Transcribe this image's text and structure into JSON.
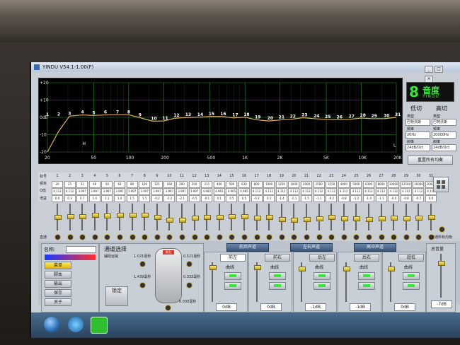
{
  "window": {
    "title": "YINDU V54.1-1.00(F)"
  },
  "graph": {
    "y_labels": [
      "+20",
      "+10",
      "0dB",
      "-10",
      "-20"
    ],
    "x_labels": [
      "20",
      "50",
      "100",
      "200",
      "500",
      "1K",
      "2K",
      "5K",
      "10K",
      "20K"
    ],
    "band_markers": [
      "1",
      "2",
      "3",
      "4",
      "5",
      "6",
      "7",
      "8",
      "9",
      "10",
      "11",
      "12",
      "13",
      "14",
      "15",
      "16",
      "17",
      "18",
      "19",
      "20",
      "21",
      "22",
      "23",
      "24",
      "25",
      "26",
      "27",
      "28",
      "29",
      "30",
      "31"
    ],
    "hp_marker": "H",
    "lp_marker": "L"
  },
  "logo": {
    "digit": "8",
    "cn": "音度",
    "en": "YINDU"
  },
  "filters": {
    "low_cut": "低切",
    "high_cut": "高切",
    "type_label": "类型",
    "freq_label": "频率",
    "slope_label": "斜率",
    "low_type": "巴特沃斯",
    "high_type": "巴特沃斯",
    "low_freq": "20Hz",
    "high_freq": "20000Hz",
    "low_slope": "24dB/Oct",
    "high_slope": "24dB/Oct",
    "reset_button": "重置所有均衡"
  },
  "eq": {
    "row_labels": [
      "标号",
      "频率",
      "Q值",
      "增益"
    ],
    "bands": [
      "1",
      "2",
      "3",
      "4",
      "5",
      "6",
      "7",
      "8",
      "9",
      "10",
      "11",
      "12",
      "13",
      "14",
      "15",
      "16",
      "17",
      "18",
      "19",
      "20",
      "21",
      "22",
      "23",
      "24",
      "25",
      "26",
      "27",
      "28",
      "29",
      "30",
      "31"
    ],
    "freqs": [
      "20",
      "25",
      "31",
      "40",
      "50",
      "63",
      "80",
      "100",
      "125",
      "160",
      "200",
      "250",
      "315",
      "400",
      "500",
      "630",
      "800",
      "1000",
      "1250",
      "1600",
      "2000",
      "2500",
      "3150",
      "4000",
      "5000",
      "6300",
      "8000",
      "10000",
      "12500",
      "16000",
      "20000"
    ],
    "q": [
      "4.112",
      "4.112",
      "3.997",
      "3.997",
      "3.997",
      "3.997",
      "3.997",
      "3.997",
      "3.997",
      "3.997",
      "3.997",
      "3.997",
      "4.965",
      "4.965",
      "4.965",
      "4.965",
      "4.112",
      "4.112",
      "4.112",
      "4.112",
      "4.112",
      "4.112",
      "4.112",
      "4.112",
      "4.112",
      "4.112",
      "4.112",
      "4.112",
      "4.112",
      "4.112",
      "4.112"
    ],
    "gains": [
      "0.0",
      "0.3",
      "0.7",
      "1.4",
      "1.1",
      "1.4",
      "1.5",
      "1.5",
      "-0.2",
      "-2.2",
      "-2.1",
      "-0.5",
      "-0.1",
      "0.1",
      "0.5",
      "0.5",
      "-0.3",
      "0.1",
      "-1.4",
      "-2.1",
      "-1.5",
      "-1.1",
      "-0.2",
      "-0.8",
      "-1.2",
      "-1.4",
      "-1.1",
      "-0.4",
      "-0.8",
      "-0.7",
      "0.0"
    ],
    "bypass_label": "直通",
    "bypass_all_label": "直通所有均衡"
  },
  "bottom": {
    "name_label": "名称:",
    "menu_items": [
      "菜单",
      "脚本",
      "输出",
      "保存",
      "关于"
    ],
    "channel_select_label": "通道选择",
    "channel_sub": "辅助运输",
    "delay_title": "前左",
    "delays": [
      "1.021毫秒",
      "0.521毫秒",
      "1.439毫秒",
      "0.333毫秒",
      "0.000毫秒"
    ],
    "center_label": "前左",
    "link_buttons": [
      "前后声道",
      "左右声道",
      "高中声道"
    ],
    "strips": [
      {
        "name": "前左",
        "curve": "曲线",
        "db": "0dB"
      },
      {
        "name": "前右",
        "curve": "曲线",
        "db": "0dB"
      },
      {
        "name": "后左",
        "curve": "曲线",
        "db": "-1dB"
      },
      {
        "name": "后右",
        "curve": "曲线",
        "db": "-1dB"
      },
      {
        "name": "超低",
        "curve": "曲线",
        "db": "0dB"
      }
    ],
    "master_label": "总音量",
    "master_db": "-7dB",
    "lock_label": "锁定"
  },
  "colors": {
    "curve": "#e0b060",
    "grid": "#2e8b2e",
    "led": "#39e639",
    "slider": "#d8bc2e"
  }
}
